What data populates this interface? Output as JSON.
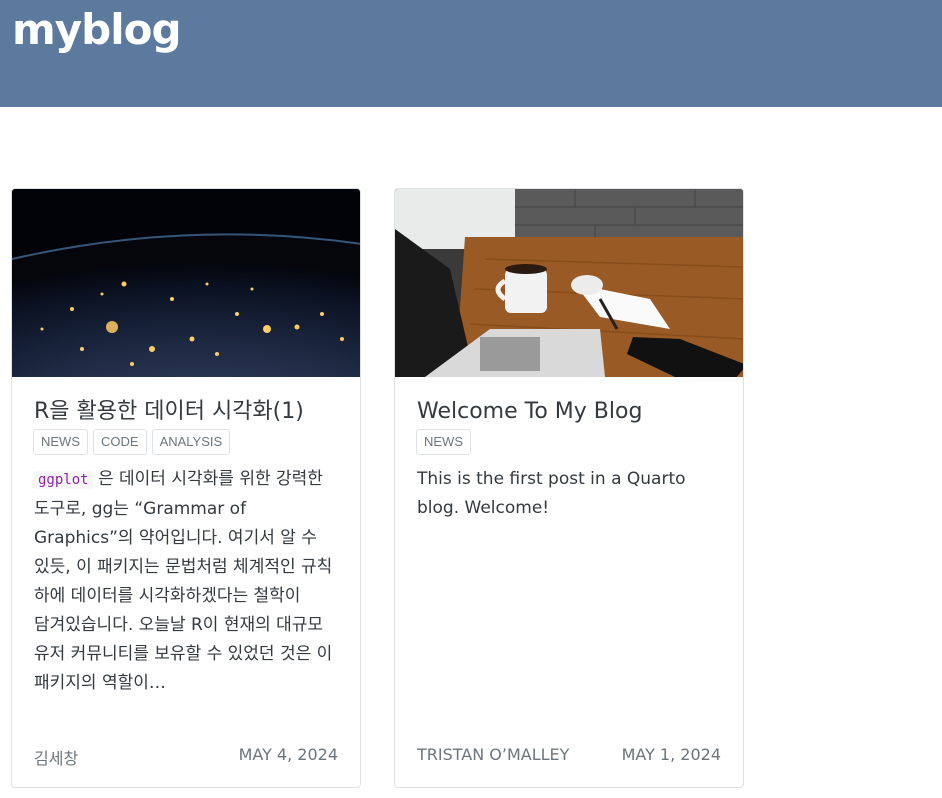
{
  "site": {
    "title": "myblog"
  },
  "posts": [
    {
      "title": "R을 활용한 데이터 시각화(1)",
      "categories": [
        "NEWS",
        "CODE",
        "ANALYSIS"
      ],
      "description_code": "ggplot",
      "description": "은 데이터 시각화를 위한 강력한 도구로, gg는 “Grammar of Graphics”의 약어입니다. 여기서 알 수 있듯, 이 패키지는 문법처럼 체계적인 규칙 하에 데이터를 시각화하겠다는 철학이 담겨있습니다. 오늘날 R이 현재의 대규모 유저 커뮤니티를 보유할 수 있었던 것은 이 패키지의 역할이…",
      "author": "김세창",
      "date": "MAY 4, 2024",
      "image_alt": "earth-at-night"
    },
    {
      "title": "Welcome To My Blog",
      "categories": [
        "NEWS"
      ],
      "description": "This is the first post in a Quarto blog. Welcome!",
      "author": "TRISTAN O’MALLEY",
      "date": "MAY 1, 2024",
      "image_alt": "laptop-on-desk"
    }
  ],
  "colors": {
    "navbar": "#5c7a9e",
    "code": "#8e24aa",
    "muted": "#6c757d"
  }
}
